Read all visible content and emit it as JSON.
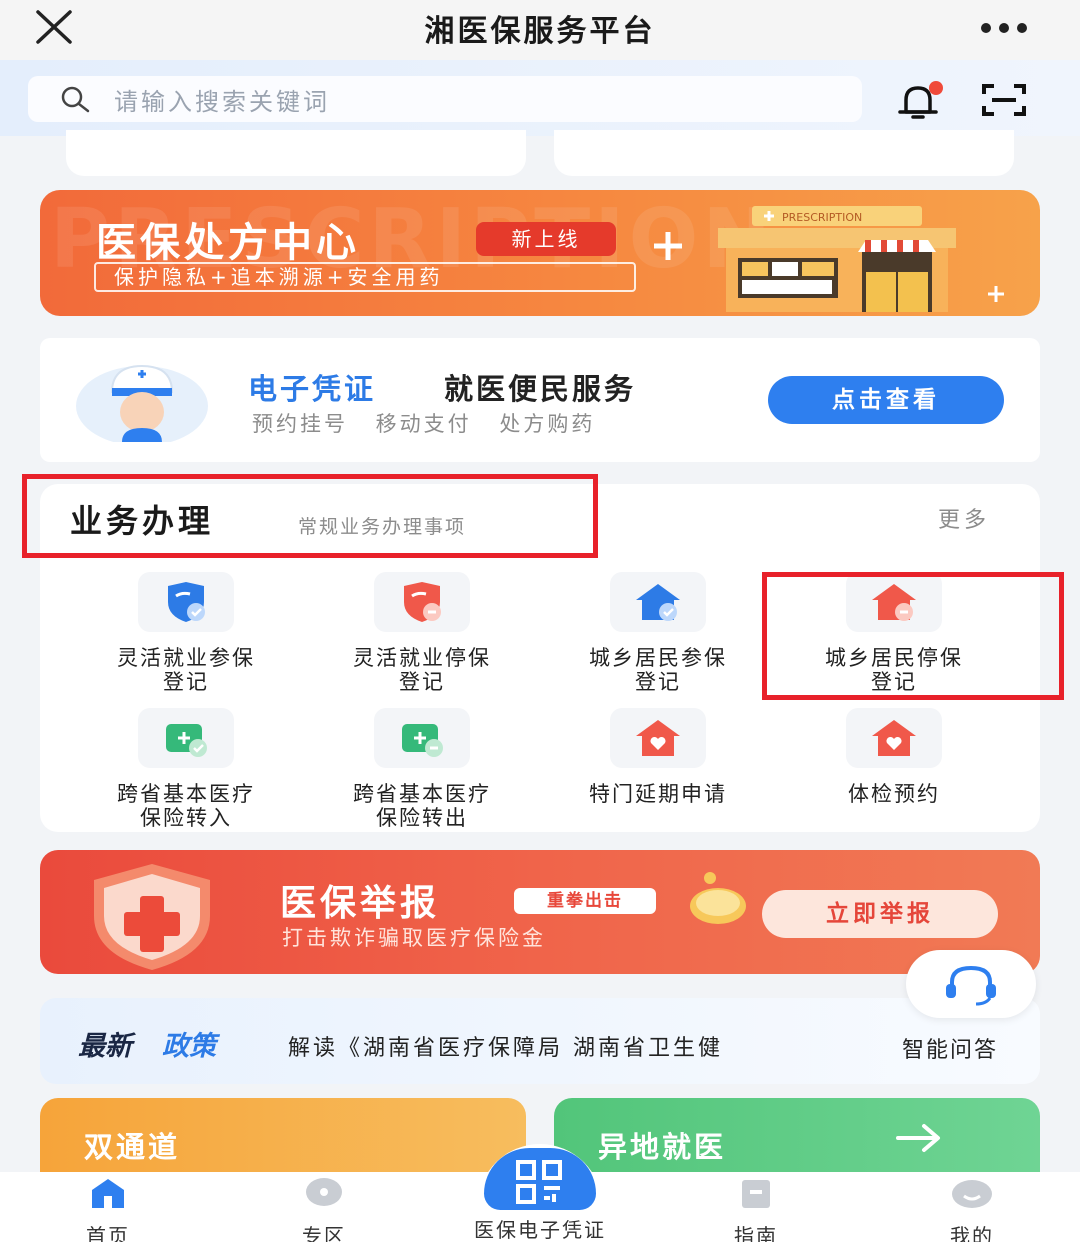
{
  "title_bar": {
    "title": "湘医保服务平台"
  },
  "search": {
    "placeholder": "请输入搜索关键词"
  },
  "prescription_banner": {
    "title": "医保处方中心",
    "badge": "新上线",
    "subtitle": "保护隐私+追本溯源+安全用药",
    "sign_text": "PRESCRIPTION"
  },
  "ecert_card": {
    "title_blue": "电子凭证",
    "title_dark": "就医便民服务",
    "subtitle": "预约挂号 移动支付 处方购药",
    "button": "点击查看"
  },
  "services": {
    "title": "业务办理",
    "subtitle": "常规业务办理事项",
    "more": "更多",
    "items": [
      {
        "label": "灵活就业参保\n登记",
        "icon": "shield-check-icon",
        "color": "#2d7be6"
      },
      {
        "label": "灵活就业停保\n登记",
        "icon": "shield-minus-icon",
        "color": "#f0584a"
      },
      {
        "label": "城乡居民参保\n登记",
        "icon": "house-check-icon",
        "color": "#2d7be6"
      },
      {
        "label": "城乡居民停保\n登记",
        "icon": "house-minus-icon",
        "color": "#f0584a"
      },
      {
        "label": "跨省基本医疗\n保险转入",
        "icon": "medical-card-in-icon",
        "color": "#35b97a"
      },
      {
        "label": "跨省基本医疗\n保险转出",
        "icon": "medical-card-out-icon",
        "color": "#35b97a"
      },
      {
        "label": "特门延期申请",
        "icon": "house-heart-icon",
        "color": "#f0584a"
      },
      {
        "label": "体检预约",
        "icon": "house-heart-icon",
        "color": "#f0584a"
      }
    ]
  },
  "report_banner": {
    "title": "医保举报",
    "badge": "重拳出击",
    "subtitle": "打击欺诈骗取医疗保险金",
    "button": "立即举报"
  },
  "policy": {
    "label_a": "最新",
    "label_b": "政策",
    "text": "解读《湖南省医疗保障局 湖南省卫生健",
    "ai_label": "智能问答"
  },
  "cards": {
    "dual_channel": "双通道",
    "remote_medical": "异地就医"
  },
  "tabs": [
    {
      "label": "首页",
      "active": true
    },
    {
      "label": "专区",
      "active": false
    },
    {
      "label": "医保电子凭证",
      "active": false
    },
    {
      "label": "指南",
      "active": false
    },
    {
      "label": "我的",
      "active": false
    }
  ],
  "colors": {
    "accent": "#2e7fef",
    "highlight_box": "#e8212a",
    "report_red": "#ea4a3c",
    "prescription_orange": "#f26a3a"
  }
}
